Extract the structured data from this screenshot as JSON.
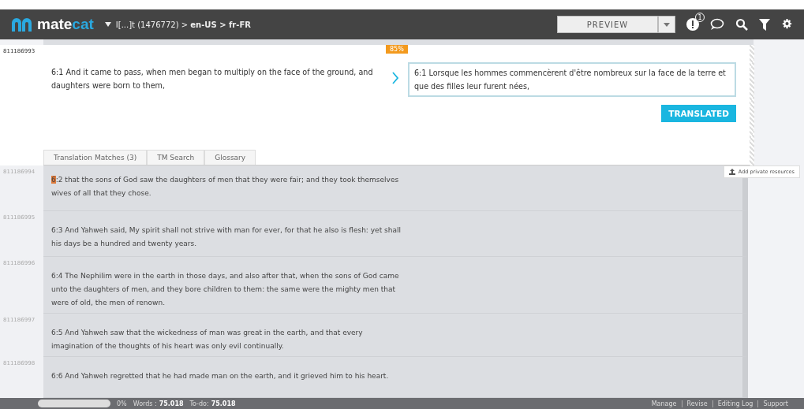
{
  "header": {
    "logo": {
      "primary": "mate",
      "accent": "cat"
    },
    "breadcrumb": "I[...]t (1476772) > **en-US > fr-FR**",
    "preview": "PREVIEW",
    "notifications": "1"
  },
  "active_segment": {
    "id": "811186993",
    "match": "85%",
    "source": "6:1 And it came to pass, when men began to multiply on the face of the ground, and daughters were born to them,",
    "target": "6:1 Lorsque les hommes commencèrent d'être nombreux sur la face de la terre et que des filles leur furent nées,",
    "button": "TRANSLATED",
    "tabs": [
      "Translation Matches (3)",
      "TM Search",
      "Glossary"
    ],
    "resources": "Add private resources"
  },
  "segments": [
    {
      "id": "811186994",
      "highlight": "6",
      "text": ":2 that the sons of God saw the daughters of men that they were fair; and they took themselves wives of all that they chose."
    },
    {
      "id": "811186995",
      "text": "6:3 And Yahweh said, My spirit shall not strive with man for ever, for that he also is flesh: yet shall his days be a hundred and twenty years."
    },
    {
      "id": "811186996",
      "text": "6:4 The Nephilim were in the earth in those days, and also after that, when the sons of God came unto the daughters of men, and they bore children to them: the same were the mighty men that were of old, the men of renown."
    },
    {
      "id": "811186997",
      "text": "6:5 And Yahweh saw that the wickedness of man was great in the earth, and that every imagination of the thoughts of his heart was only evil continually."
    },
    {
      "id": "811186998",
      "text": "6:6 And Yahweh regretted that he had made man on the earth, and it grieved him to his heart."
    }
  ],
  "footer": {
    "progress": {
      "percent": "0%"
    },
    "words_label": "Words :",
    "words": "75.018",
    "todo_label": "To-do:",
    "todo": "75.018",
    "links": [
      "Manage",
      "Revise",
      "Editing Log",
      "Support"
    ]
  }
}
